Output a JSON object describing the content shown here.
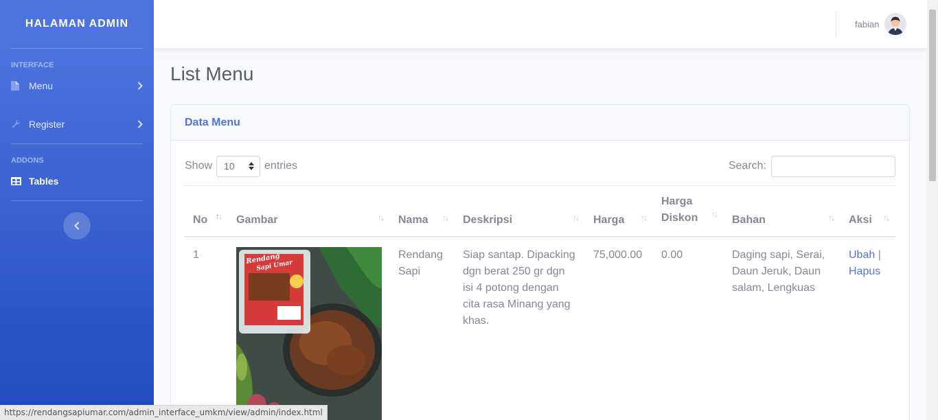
{
  "sidebar": {
    "brand": "HALAMAN ADMIN",
    "headings": {
      "interface": "INTERFACE",
      "addons": "ADDONS"
    },
    "items": [
      {
        "label": "Menu",
        "icon": "file-icon"
      },
      {
        "label": "Register",
        "icon": "wrench-icon"
      },
      {
        "label": "Tables",
        "icon": "table-icon"
      }
    ]
  },
  "topbar": {
    "user_name": "fabian"
  },
  "page": {
    "title": "List Menu"
  },
  "card": {
    "title": "Data Menu",
    "show_label": "Show",
    "entries_label": "entries",
    "length_value": "10",
    "search_label": "Search:",
    "search_value": ""
  },
  "table": {
    "columns": [
      "No",
      "Gambar",
      "Nama",
      "Deskripsi",
      "Harga",
      "Harga Diskon",
      "Bahan",
      "Aksi"
    ],
    "rows": [
      {
        "no": "1",
        "image_label_1": "Rendang",
        "image_label_2": "Sapi Umar",
        "nama": "Rendang Sapi",
        "deskripsi": "Siap santap. Dipacking dgn berat 250 gr dgn isi 4 potong dengan cita rasa Minang yang khas.",
        "harga": "75,000.00",
        "harga_diskon": "0.00",
        "bahan": "Daging sapi, Serai, Daun Jeruk, Daun salam, Lengkuas",
        "aksi_ubah": "Ubah",
        "aksi_separator": "|",
        "aksi_hapus": "Hapus"
      }
    ]
  },
  "status_bar": {
    "url": "https://rendangsapiumar.com/admin_interface_umkm/view/admin/index.html"
  },
  "colors": {
    "primary": "#4e73df",
    "sidebar_dark": "#224abe",
    "text": "#858796"
  }
}
